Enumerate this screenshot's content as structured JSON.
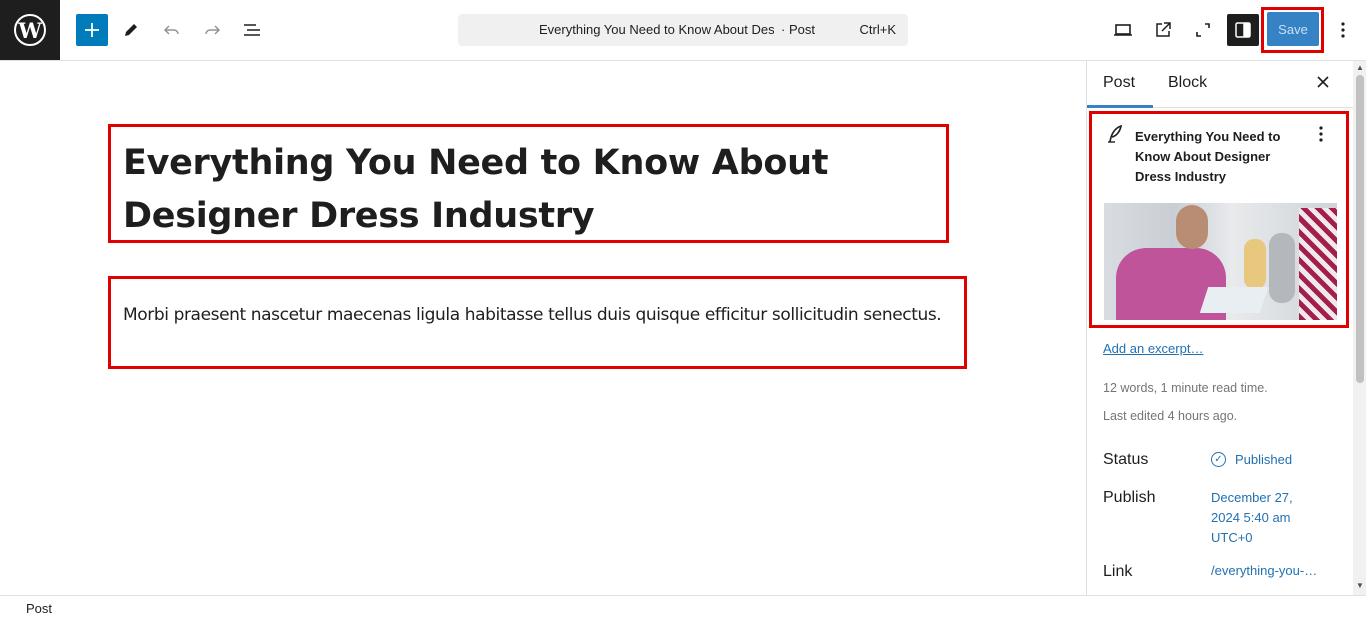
{
  "app": {
    "logo_icon": "wordpress-logo-icon"
  },
  "toolbar": {
    "add_icon": "plus-icon",
    "tools_icon": "pencil-icon",
    "undo_icon": "undo-icon",
    "redo_icon": "redo-icon",
    "list_view_icon": "list-view-icon",
    "preview_icon": "desktop-preview-icon",
    "view_post_icon": "external-link-icon",
    "fullscreen_icon": "fullscreen-icon",
    "settings_icon": "sidebar-settings-icon",
    "save_label": "Save",
    "more_icon": "vertical-ellipsis-icon"
  },
  "document_bar": {
    "title": "Everything You Need to Know About Designer Dress Industry",
    "type": "· Post",
    "shortcut": "Ctrl+K"
  },
  "editor": {
    "post_title": "Everything You Need to Know About Designer Dress Industry",
    "paragraph": "Morbi praesent nascetur maecenas ligula habitasse tellus duis quisque efficitur sollicitudin senectus."
  },
  "sidebar": {
    "tabs": [
      {
        "label": "Post",
        "active": true
      },
      {
        "label": "Block",
        "active": false
      }
    ],
    "close_icon": "close-icon",
    "card": {
      "icon": "feather-post-icon",
      "title": "Everything You Need to Know About Designer Dress Industry",
      "menu_icon": "vertical-ellipsis-icon",
      "featured_image": "featured-image"
    },
    "excerpt_link": "Add an excerpt…",
    "word_count": "12 words, 1 minute read time.",
    "last_edited": "Last edited 4 hours ago.",
    "rows": [
      {
        "label": "Status",
        "value": "Published",
        "icon": "check-circle-icon"
      },
      {
        "label": "Publish",
        "value_lines": [
          "December 27,",
          "2024 5:40 am",
          "UTC+0"
        ]
      },
      {
        "label": "Link",
        "value": "/everything-you-…"
      }
    ]
  },
  "footer": {
    "breadcrumb": "Post"
  },
  "colors": {
    "accent": "#007cba",
    "save_button": "#3582c4",
    "link": "#2271b1",
    "highlight_border": "#e00000",
    "dark": "#1e1e1e"
  }
}
